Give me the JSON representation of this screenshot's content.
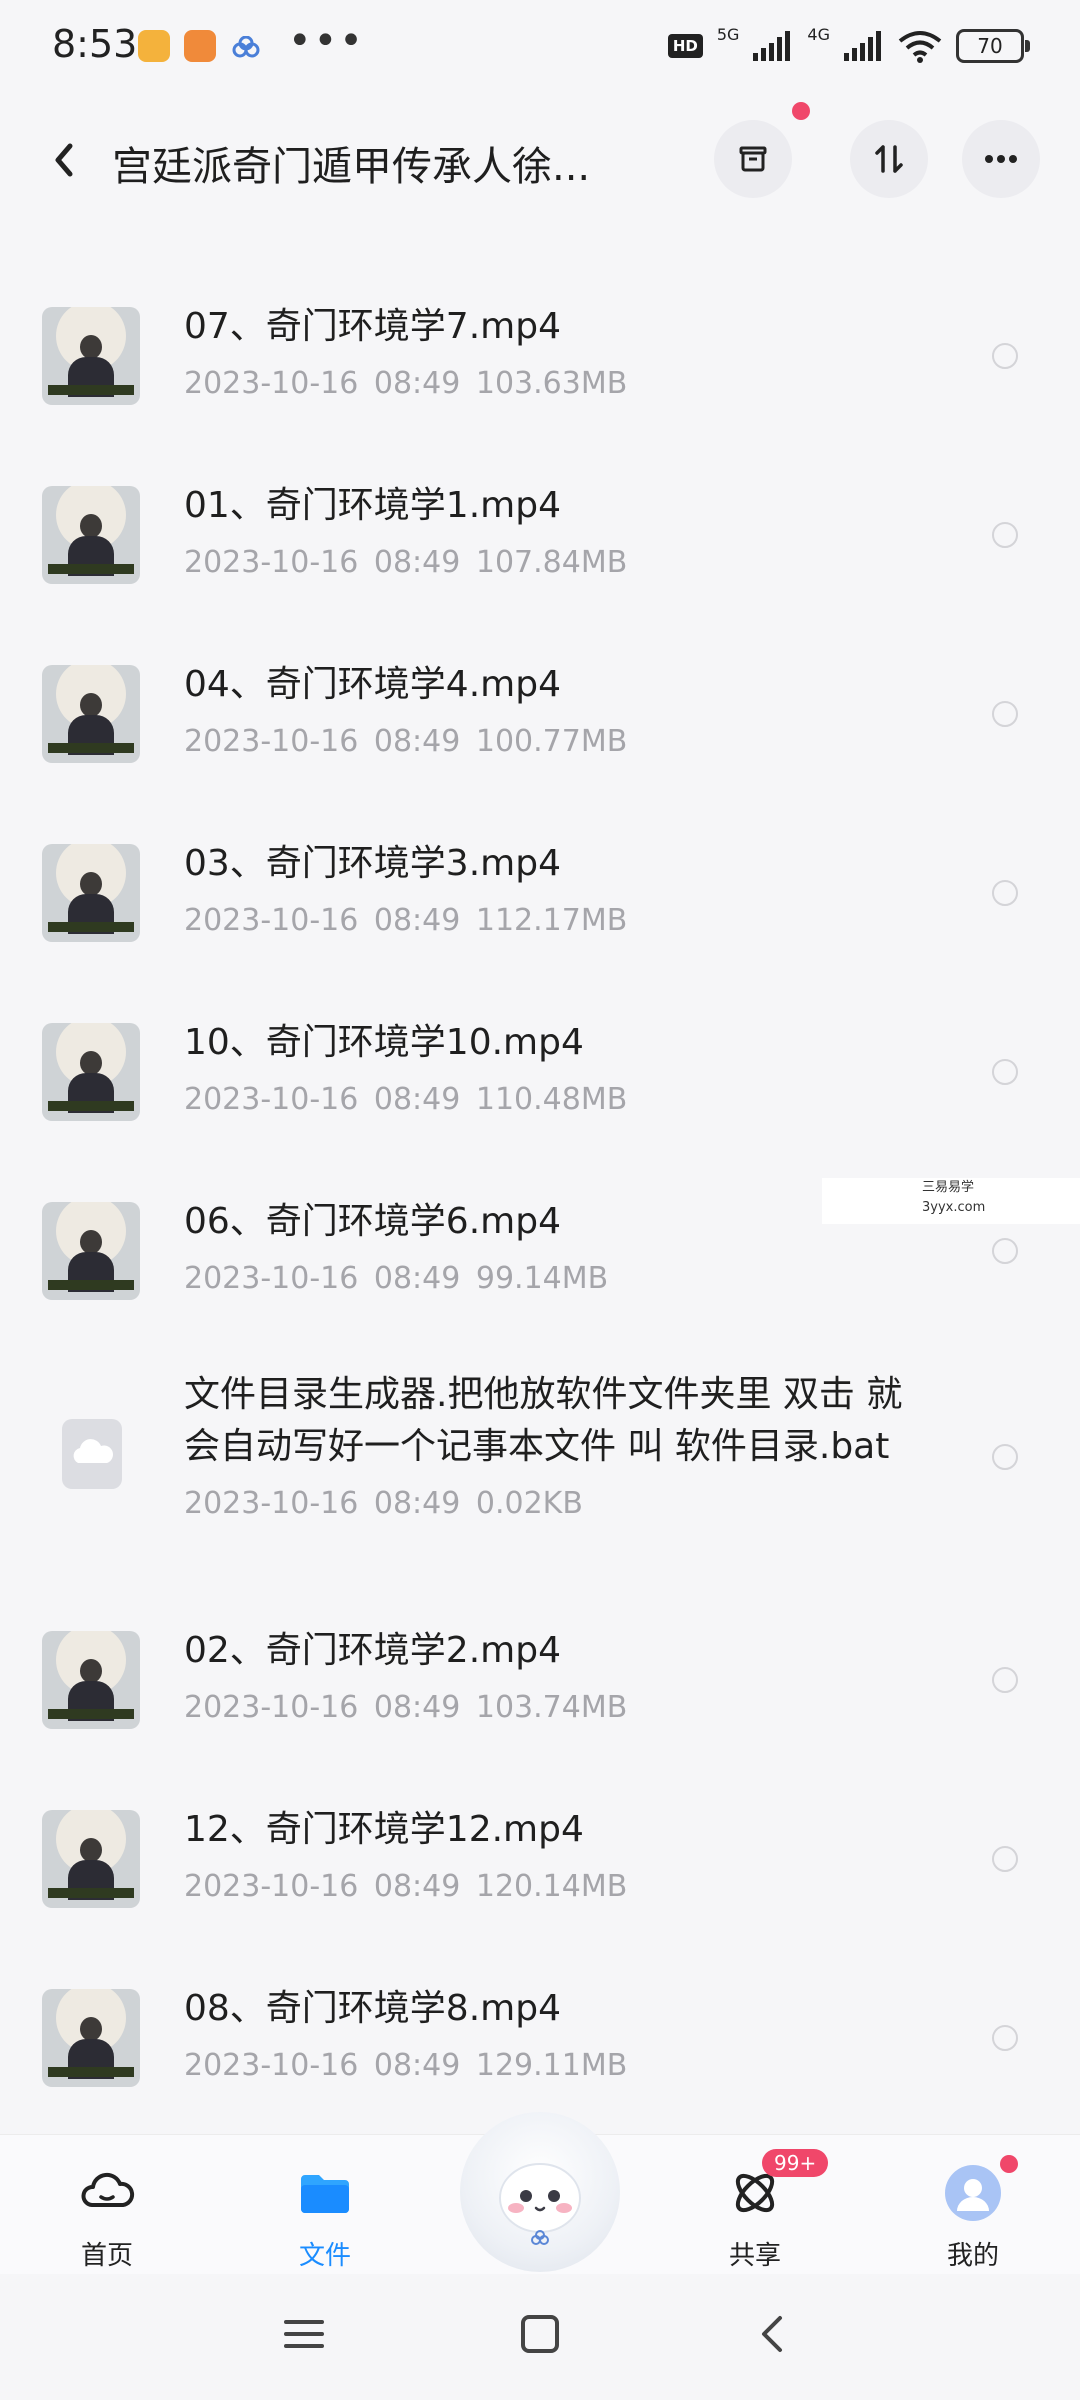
{
  "status_bar": {
    "time": "8:53",
    "network_1": "5G",
    "network_2": "4G",
    "battery": "70"
  },
  "header": {
    "title": "宫廷派奇门遁甲传承人徐..."
  },
  "files": [
    {
      "name": "07、奇门环境学7.mp4",
      "meta": "2023-10-16  08:49  103.63MB",
      "type": "video",
      "thumbnail": "video-thumbnail"
    },
    {
      "name": "01、奇门环境学1.mp4",
      "meta": "2023-10-16  08:49  107.84MB",
      "type": "video",
      "thumbnail": "video-thumbnail"
    },
    {
      "name": "04、奇门环境学4.mp4",
      "meta": "2023-10-16  08:49  100.77MB",
      "type": "video",
      "thumbnail": "video-thumbnail"
    },
    {
      "name": "03、奇门环境学3.mp4",
      "meta": "2023-10-16  08:49  112.17MB",
      "type": "video",
      "thumbnail": "video-thumbnail"
    },
    {
      "name": "10、奇门环境学10.mp4",
      "meta": "2023-10-16  08:49  110.48MB",
      "type": "video",
      "thumbnail": "video-thumbnail"
    },
    {
      "name": "06、奇门环境学6.mp4",
      "meta": "2023-10-16  08:49  99.14MB",
      "type": "video",
      "thumbnail": "video-thumbnail"
    },
    {
      "name_line1": "文件目录生成器.把他放软件文件夹里 双击 就",
      "name_line2": "会自动写好一个记事本文件 叫 软件目录.bat",
      "meta": "2023-10-16  08:49  0.02KB",
      "type": "file",
      "thumbnail": "cloud-file-icon"
    },
    {
      "name": "02、奇门环境学2.mp4",
      "meta": "2023-10-16  08:49  103.74MB",
      "type": "video",
      "thumbnail": "video-thumbnail"
    },
    {
      "name": "12、奇门环境学12.mp4",
      "meta": "2023-10-16  08:49  120.14MB",
      "type": "video",
      "thumbnail": "video-thumbnail"
    },
    {
      "name": "08、奇门环境学8.mp4",
      "meta": "2023-10-16  08:49  129.11MB",
      "type": "video",
      "thumbnail": "video-thumbnail"
    }
  ],
  "watermark": {
    "line1": "三易易学",
    "line2": "3yyx.com"
  },
  "tabs": [
    {
      "label": "首页",
      "icon": "cloud-icon",
      "active": false
    },
    {
      "label": "文件",
      "icon": "folder-icon",
      "active": true
    },
    {
      "label": "共享",
      "icon": "share-orbit-icon",
      "active": false,
      "badge": "99+"
    },
    {
      "label": "我的",
      "icon": "avatar-icon",
      "active": false
    }
  ],
  "colors": {
    "accent": "#1a8cff",
    "badge": "#f0476a",
    "meta_text": "#a5a5aa"
  }
}
